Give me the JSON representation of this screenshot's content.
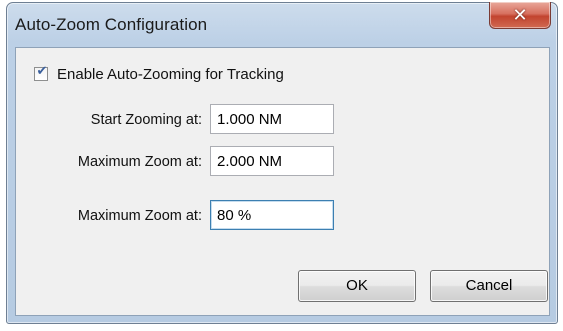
{
  "window": {
    "title": "Auto-Zoom Configuration",
    "close_glyph": "✕"
  },
  "enable_checkbox": {
    "label": "Enable Auto-Zooming for Tracking",
    "checked": true,
    "tick_glyph": "✔"
  },
  "fields": {
    "start_zoom": {
      "label": "Start Zooming at:",
      "value": "1.000 NM"
    },
    "max_zoom_distance": {
      "label": "Maximum Zoom at:",
      "value": "2.000 NM"
    },
    "max_zoom_percent": {
      "label": "Maximum Zoom at:",
      "value": "80 %"
    }
  },
  "buttons": {
    "ok": "OK",
    "cancel": "Cancel"
  }
}
